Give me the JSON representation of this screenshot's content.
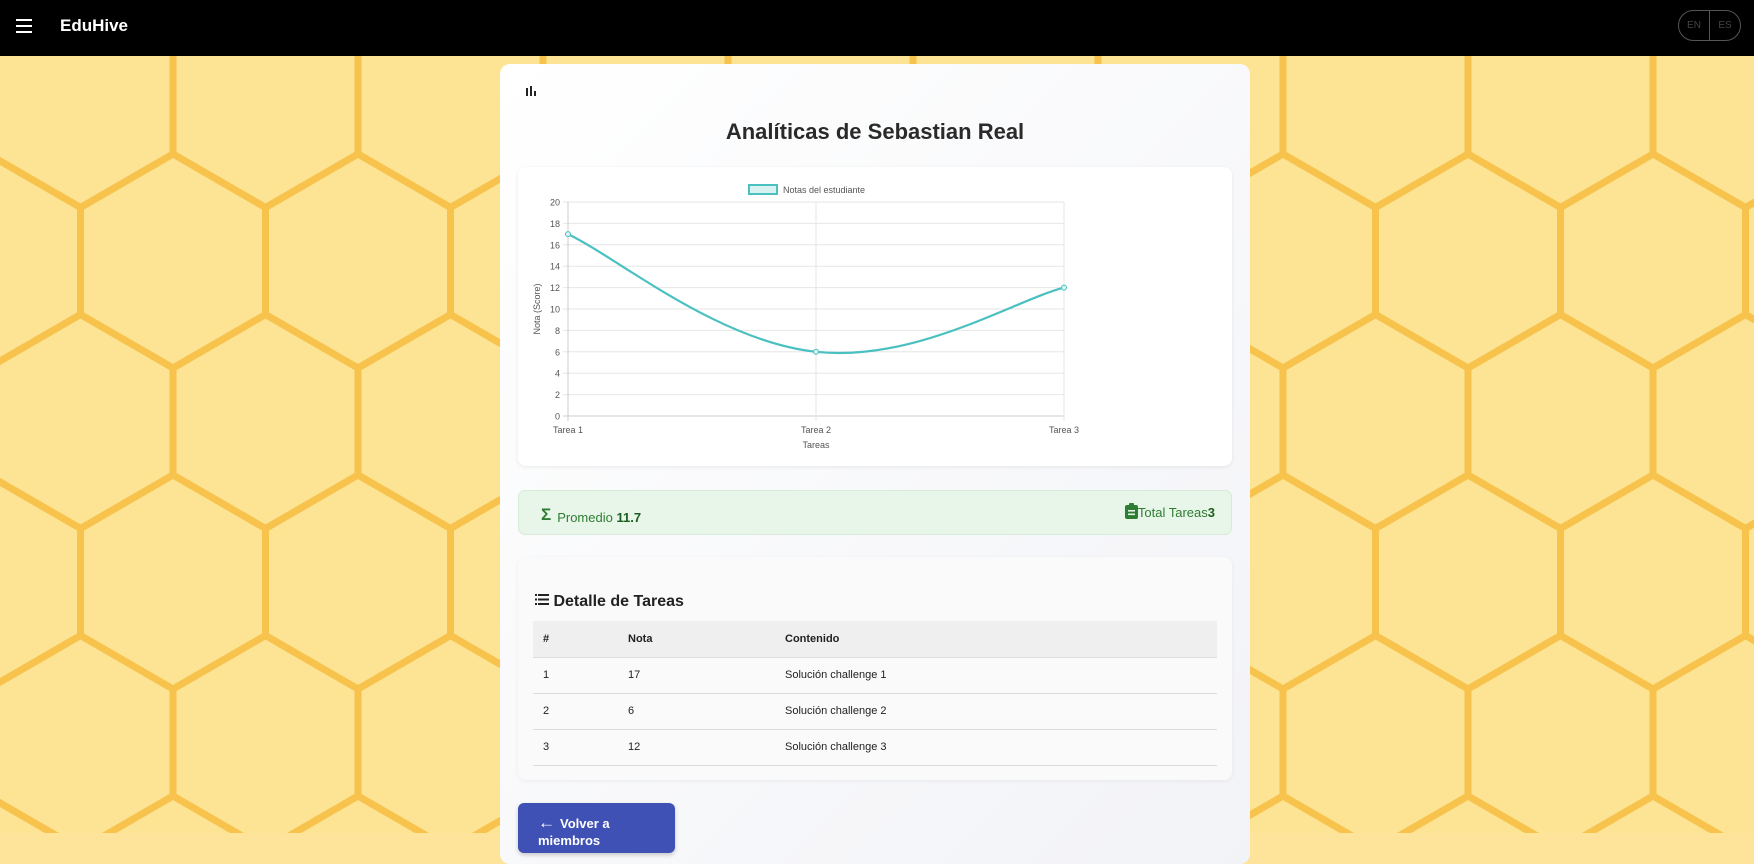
{
  "nav": {
    "brand": "EduHive",
    "lang": [
      "EN",
      "ES"
    ],
    "menu_icon": "hamburger-icon"
  },
  "page": {
    "title": "Analíticas de Sebastian Real",
    "header_icon": "bar-chart-icon"
  },
  "chart_data": {
    "type": "line",
    "categories": [
      "Tarea 1",
      "Tarea 2",
      "Tarea 3"
    ],
    "series": [
      {
        "name": "Notas del estudiante",
        "values": [
          17,
          6,
          12
        ],
        "color": "#4bc0c0"
      }
    ],
    "xlabel": "Tareas",
    "ylabel": "Nota (Score)",
    "ylim": [
      0,
      20
    ],
    "yticks": [
      0,
      2,
      4,
      6,
      8,
      10,
      12,
      14,
      16,
      18,
      20
    ],
    "grid": true,
    "legend": "top"
  },
  "stats": {
    "avg_label": "Promedio",
    "avg_value": "11.7",
    "total_label": "Total Tareas",
    "total_value": "3"
  },
  "table": {
    "title": "Detalle de Tareas",
    "headers": [
      "#",
      "Nota",
      "Contenido"
    ],
    "rows": [
      [
        "1",
        "17",
        "Solución challenge 1"
      ],
      [
        "2",
        "6",
        "Solución challenge 2"
      ],
      [
        "3",
        "12",
        "Solución challenge 3"
      ]
    ]
  },
  "back_button": "Volver a miembros"
}
